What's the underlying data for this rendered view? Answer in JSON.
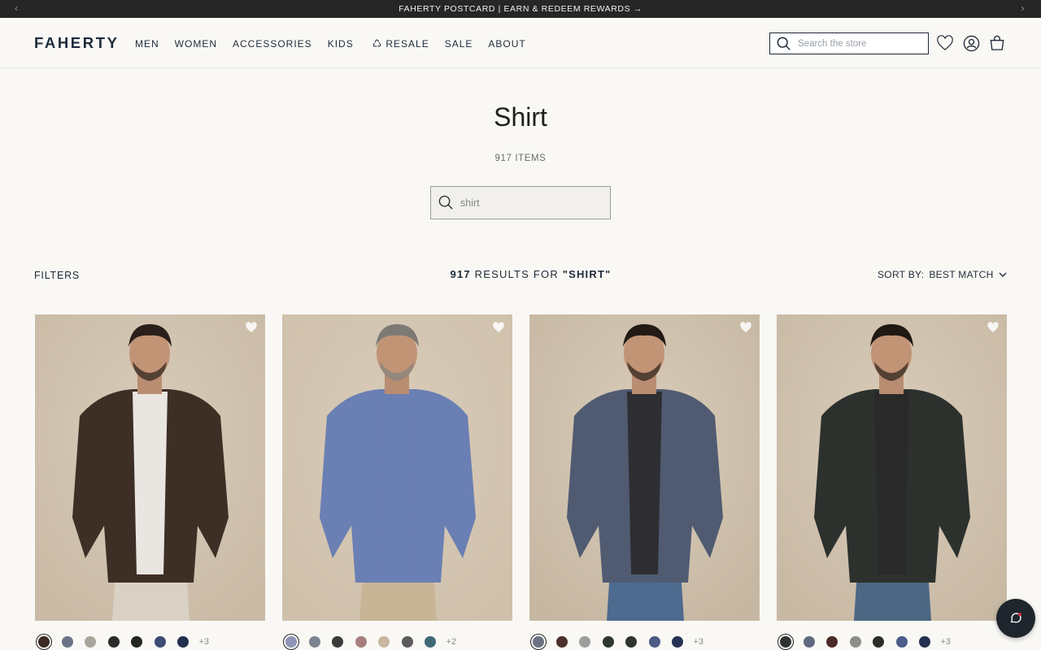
{
  "promo": {
    "text": "FAHERTY POSTCARD | EARN & REDEEM REWARDS →",
    "prev": "‹",
    "next": "›"
  },
  "header": {
    "logo": "FAHERTY",
    "nav": [
      "MEN",
      "WOMEN",
      "ACCESSORIES",
      "KIDS",
      "RESALE",
      "SALE",
      "ABOUT"
    ],
    "resale_icon": "♺",
    "search_placeholder": "Search the store"
  },
  "page": {
    "title": "Shirt",
    "count": "917 ITEMS",
    "search_value": "shirt"
  },
  "toolbar": {
    "filters": "FILTERS",
    "results_count": "917",
    "results_text": " RESULTS FOR ",
    "results_query": "\"SHIRT\"",
    "sort_label": "SORT BY:",
    "sort_value": "BEST MATCH"
  },
  "products": [
    {
      "bg": "#c9baa5",
      "shirt": "#3e2f26",
      "under": "#f2f0ec",
      "pants": "#d9d1c4",
      "hair": "#2a1f1a",
      "gray": false,
      "swatches": [
        "#3a2a22",
        "#6a7486",
        "#a8a49b",
        "#2b2b2b",
        "#222622",
        "#3d4b72",
        "#22304d"
      ],
      "more": "+3"
    },
    {
      "bg": "#cfc0ab",
      "shirt": "#6a7fb3",
      "under": "#6a7fb3",
      "pants": "#c7b596",
      "hair": "#7d7a76",
      "gray": true,
      "swatches": [
        "#8e95b8",
        "#7b8290",
        "#3a3a3a",
        "#a77e7e",
        "#c9b7a0",
        "#5d5a5e",
        "#3f6876"
      ],
      "more": "+2"
    },
    {
      "bg": "#c6b7a2",
      "shirt": "#505b72",
      "under": "#2c2c2e",
      "pants": "#4d6a8f",
      "hair": "#231a15",
      "gray": false,
      "swatches": [
        "#6d7284",
        "#4a2f2a",
        "#9d9d9d",
        "#2f3530",
        "#30342e",
        "#4c5a85",
        "#253252"
      ],
      "more": "+3"
    },
    {
      "bg": "#c8b9a4",
      "shirt": "#2d312e",
      "under": "#2a2a2a",
      "pants": "#4c6784",
      "hair": "#1f1813",
      "gray": false,
      "swatches": [
        "#2f3331",
        "#5f6a82",
        "#4a2b27",
        "#8e8d88",
        "#2b2e27",
        "#4b5c8a",
        "#243051"
      ],
      "more": "+3"
    }
  ]
}
